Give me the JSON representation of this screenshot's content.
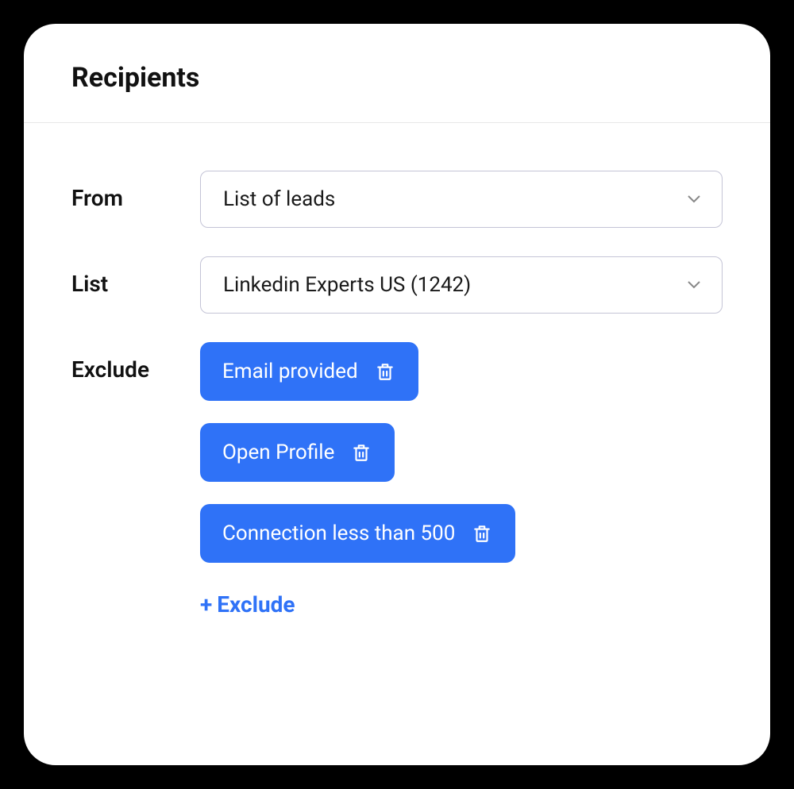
{
  "title": "Recipients",
  "form": {
    "from": {
      "label": "From",
      "value": "List of leads"
    },
    "list": {
      "label": "List",
      "value": "Linkedin Experts US (1242)"
    },
    "exclude": {
      "label": "Exclude",
      "chips": [
        "Email provided",
        "Open Profile",
        "Connection less than 500"
      ],
      "add_label": "Exclude",
      "add_prefix": "+"
    }
  }
}
